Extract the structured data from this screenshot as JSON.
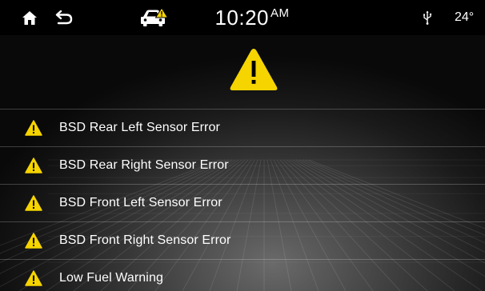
{
  "status_bar": {
    "home_icon": "home-icon",
    "back_icon": "back-arrow-icon",
    "car_warning_icon": "car-warning-icon",
    "time": "10:20",
    "ampm": "AM",
    "usb_icon": "usb-icon",
    "temperature": "24°"
  },
  "header": {
    "warning_icon": "warning-triangle-icon"
  },
  "errors": [
    {
      "label": "BSD Rear Left Sensor Error",
      "icon": "warning-icon"
    },
    {
      "label": "BSD Rear Right Sensor Error",
      "icon": "warning-icon"
    },
    {
      "label": "BSD Front Left Sensor Error",
      "icon": "warning-icon"
    },
    {
      "label": "BSD Front Right Sensor Error",
      "icon": "warning-icon"
    },
    {
      "label": "Low Fuel Warning",
      "icon": "warning-icon"
    }
  ],
  "colors": {
    "warning_yellow": "#f5d400",
    "text": "#ffffff",
    "status_bar_bg": "#000000"
  }
}
